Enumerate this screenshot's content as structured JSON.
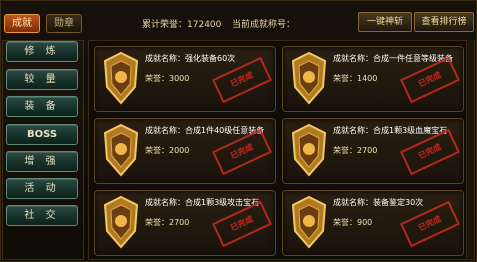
{
  "tabs": {
    "achievements": "成就",
    "medals": "勋章"
  },
  "header": {
    "honor_label": "累计荣誉：",
    "honor_value": "172400",
    "title_label": "当前成就称号："
  },
  "buttons": {
    "refresh": "一键神斩",
    "leaderboard": "查看排行榜"
  },
  "sidebar": {
    "items": [
      {
        "label": "修 炼"
      },
      {
        "label": "较 量"
      },
      {
        "label": "装 备"
      },
      {
        "label": "BOSS"
      },
      {
        "label": "增 强"
      },
      {
        "label": "活 动"
      },
      {
        "label": "社 交"
      }
    ]
  },
  "cards": [
    {
      "name": "成就名称：强化装备60次",
      "honor": "荣誉：3000",
      "stamp": "已完成"
    },
    {
      "name": "成就名称：合成一件任意等级装备",
      "honor": "荣誉：1400",
      "stamp": "已完成"
    },
    {
      "name": "成就名称：合成1件40级任意装备",
      "honor": "荣誉：2000",
      "stamp": "已完成"
    },
    {
      "name": "成就名称：合成1颗3级血魔宝石",
      "honor": "荣誉：2700",
      "stamp": "已完成"
    },
    {
      "name": "成就名称：合成1颗3级攻击宝石",
      "honor": "荣誉：2700",
      "stamp": "已完成"
    },
    {
      "name": "成就名称：装备鉴定30次",
      "honor": "荣誉：900",
      "stamp": "已完成"
    }
  ]
}
